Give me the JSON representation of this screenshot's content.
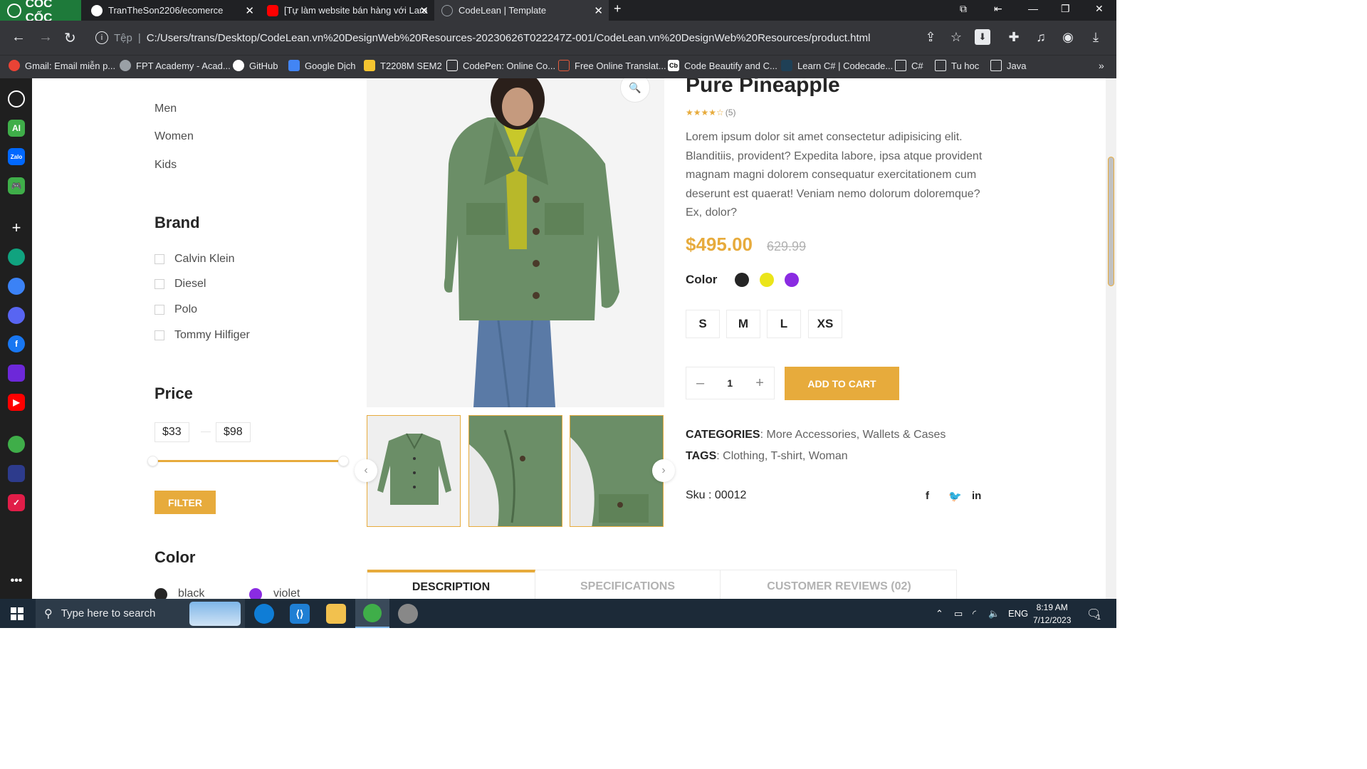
{
  "browser": {
    "logo_text": "CỐC CỐC",
    "tabs": [
      {
        "title": "TranTheSon2206/ecomerce",
        "icon": "github-icon"
      },
      {
        "title": "[Tự làm website bán hàng với Lara",
        "icon": "youtube-icon"
      },
      {
        "title": "CodeLean | Template",
        "icon": "globe-icon"
      }
    ],
    "url_label": "Tệp",
    "url": "C:/Users/trans/Desktop/CodeLean.vn%20DesignWeb%20Resources-20230626T022247Z-001/CodeLean.vn%20DesignWeb%20Resources/product.html",
    "bookmarks": [
      "Gmail: Email miễn p...",
      "FPT Academy - Acad...",
      "GitHub",
      "Google Dịch",
      "T2208M SEM2",
      "CodePen: Online Co...",
      "Free Online Translat...",
      "Code Beautify and C...",
      "Learn C# | Codecade...",
      "C#",
      "Tu hoc",
      "Java"
    ]
  },
  "shop": {
    "categories": [
      "Men",
      "Women",
      "Kids"
    ],
    "brand_title": "Brand",
    "brands": [
      "Calvin Klein",
      "Diesel",
      "Polo",
      "Tommy Hilfiger"
    ],
    "price_title": "Price",
    "price_min": "$33",
    "price_max": "$98",
    "filter_label": "FILTER",
    "color_title": "Color",
    "colors": [
      {
        "label": "black",
        "hex": "#252525"
      },
      {
        "label": "violet",
        "hex": "#8a2be2"
      }
    ]
  },
  "product": {
    "title": "Pure Pineapple",
    "rating_stars": "★★★★☆",
    "rating_count": "(5)",
    "description": "Lorem ipsum dolor sit amet consectetur adipisicing elit. Blanditiis, provident? Expedita labore, ipsa atque provident magnam magni dolorem consequatur exercitationem cum deserunt est quaerat! Veniam nemo dolorum doloremque? Ex, dolor?",
    "price": "$495.00",
    "old_price": "629.99",
    "color_label": "Color",
    "swatches": [
      "#252525",
      "#ebe51a",
      "#8a2be2"
    ],
    "sizes": [
      "S",
      "M",
      "L",
      "XS"
    ],
    "quantity": "1",
    "add_to_cart": "ADD TO CART",
    "categories_label": "CATEGORIES",
    "categories_value": ": More Accessories, Wallets & Cases",
    "tags_label": "TAGS",
    "tags_value": ": Clothing, T-shirt, Woman",
    "sku": "Sku : 00012",
    "tabs": [
      "DESCRIPTION",
      "SPECIFICATIONS",
      "CUSTOMER REVIEWS (02)"
    ]
  },
  "taskbar": {
    "search_placeholder": "Type here to search",
    "language": "ENG",
    "time": "8:19 AM",
    "date": "7/12/2023",
    "notification_count": "1"
  },
  "theme": {
    "accent": "#e7ab3c",
    "browser_dark": "#35363a"
  }
}
